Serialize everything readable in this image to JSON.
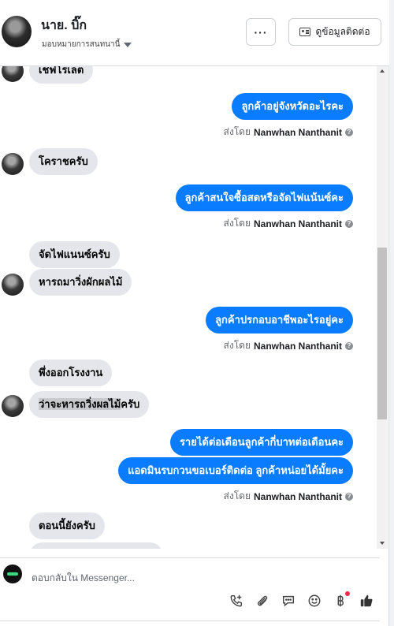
{
  "header": {
    "name": "นาย. บิ๊ก",
    "assign_label": "มอบหมายการสนทนานี้",
    "more_label": "···",
    "contact_button": "ดูข้อมูลติดต่อ"
  },
  "sent_prefix": "ส่งโดย",
  "sender_name": "Nanwhan Nanthanit",
  "messages": {
    "m0": "เชฟโรเลต",
    "m1": "ลูกค้าอยู่จังหวัดอะไรคะ",
    "m2": "โคราชครับ",
    "m3": "ลูกค้าสนใจซื้อสดหรือจัดไฟแน้นซ์คะ",
    "m4": "จัดไฟแนนซ์ครับ",
    "m5": "หารถมาวิ่งผักผลไม้",
    "m6": "ลูกค้าปรกอบอาชีพอะไรอยู่คะ",
    "m7": "พึ่งออกโรงงาน",
    "m8_sel": "ว่าจะหารถวิ่งผลไม้",
    "m8_rest": "ครับ",
    "m9": "รายได้ต่อเดือนลูกค้ากี่บาทต่อเดือนคะ",
    "m10": "แอดมินรบกวนขอเบอร์ติดต่อ ลูกค้าหน่อยได้มั้ยคะ",
    "m11": "ตอนนี้ยังครับ"
  },
  "composer": {
    "placeholder": "ตอบกลับใน Messenger..."
  },
  "icons": [
    "call-add-icon",
    "attachment-icon",
    "chat-bubble-icon",
    "smiley-icon",
    "baht-icon",
    "thumbs-up-icon"
  ],
  "colors": {
    "outgoing": "#0a7cff",
    "incoming": "#e4e6eb"
  }
}
